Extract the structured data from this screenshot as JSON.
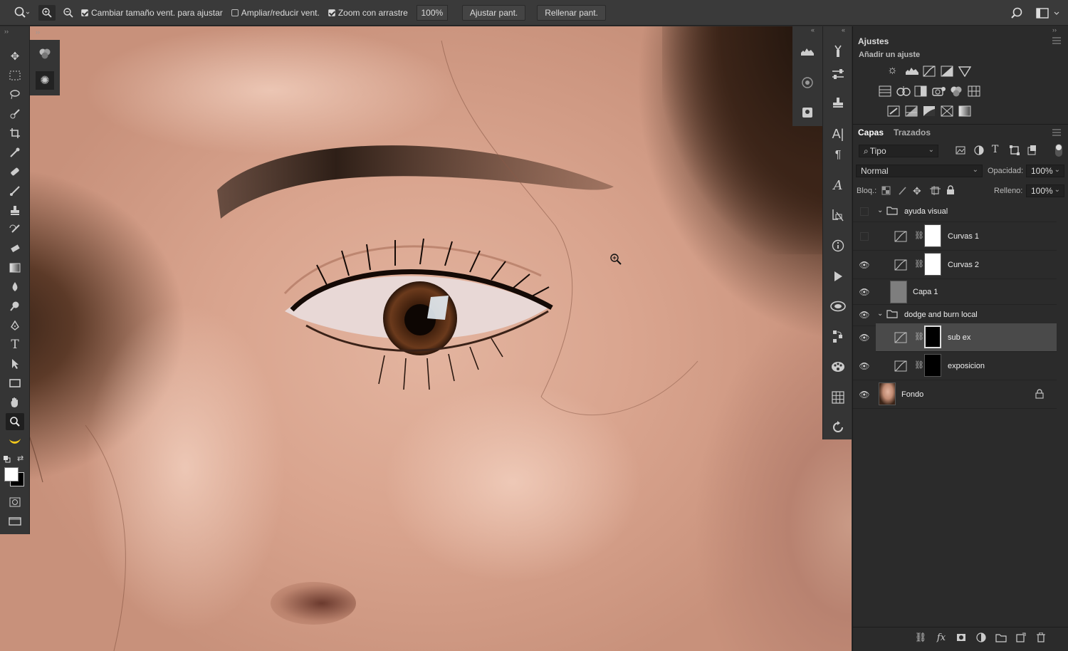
{
  "options_bar": {
    "resize_windows_label": "Cambiar tamaño vent. para ajustar",
    "resize_windows_checked": true,
    "zoom_all_windows_label": "Ampliar/reducir vent.",
    "zoom_all_windows_checked": false,
    "scrubby_zoom_label": "Zoom con arrastre",
    "scrubby_zoom_checked": true,
    "zoom_percent": "100%",
    "fit_screen_label": "Ajustar pant.",
    "fill_screen_label": "Rellenar pant."
  },
  "adjustments_panel": {
    "title": "Ajustes",
    "subtitle": "Añadir un ajuste"
  },
  "layers_panel": {
    "tabs": [
      {
        "label": "Capas",
        "selected": true
      },
      {
        "label": "Trazados",
        "selected": false
      }
    ],
    "filter_label": "Tipo",
    "blend_mode": "Normal",
    "opacity_label": "Opacidad:",
    "opacity_value": "100%",
    "lock_label": "Bloq.:",
    "fill_label": "Relleno:",
    "fill_value": "100%",
    "layers": [
      {
        "name": "ayuda visual",
        "type": "group",
        "visible": false,
        "expanded": true
      },
      {
        "name": "Curvas 1",
        "type": "curves",
        "visible": false,
        "mask": "white"
      },
      {
        "name": "Curvas 2",
        "type": "curves",
        "visible": true,
        "mask": "white"
      },
      {
        "name": "Capa 1",
        "type": "pixel",
        "visible": true,
        "thumb": "gray"
      },
      {
        "name": "dodge and burn local",
        "type": "group",
        "visible": true,
        "expanded": true
      },
      {
        "name": "sub ex",
        "type": "curves",
        "visible": true,
        "mask": "black",
        "selected": true
      },
      {
        "name": "exposicion",
        "type": "curves",
        "visible": true,
        "mask": "black"
      },
      {
        "name": "Fondo",
        "type": "background",
        "visible": true,
        "locked": true
      }
    ]
  },
  "colors": {
    "foreground": "#ffffff",
    "background": "#000000"
  }
}
